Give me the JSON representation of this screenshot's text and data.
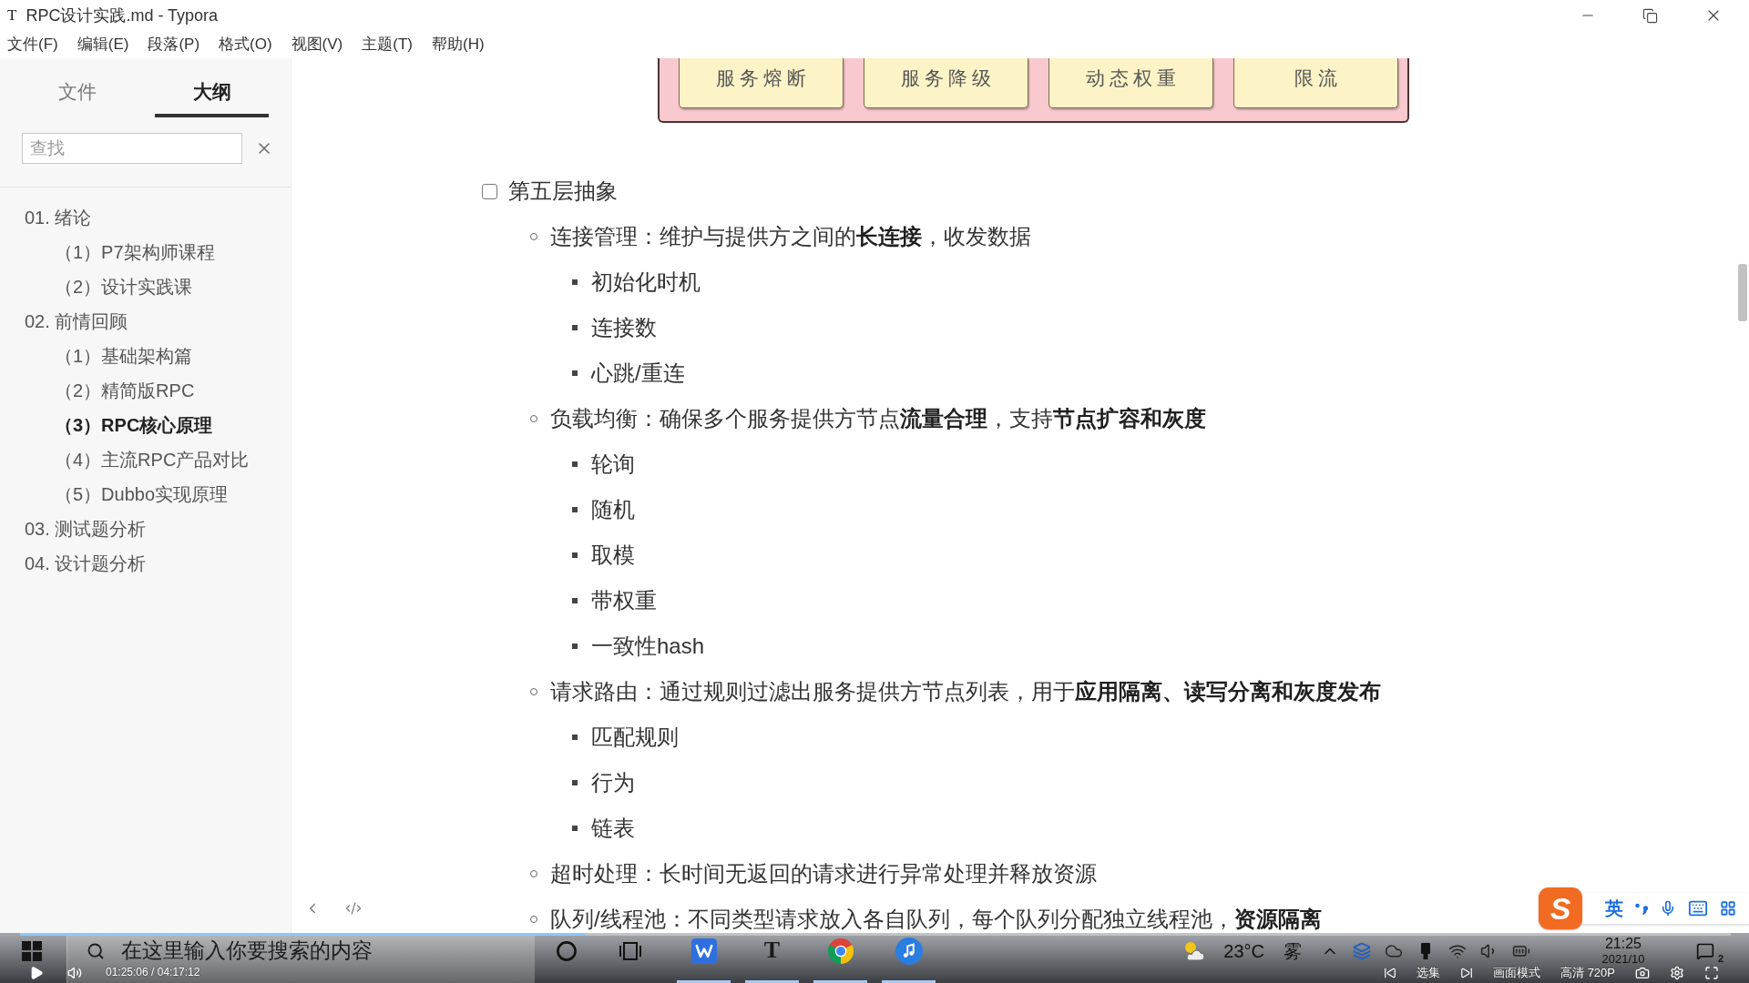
{
  "window": {
    "icon": "T",
    "title": "RPC设计实践.md - Typora"
  },
  "menu": [
    "文件(F)",
    "编辑(E)",
    "段落(P)",
    "格式(O)",
    "视图(V)",
    "主题(T)",
    "帮助(H)"
  ],
  "sidebar": {
    "tabs": [
      {
        "label": "文件",
        "selected": false
      },
      {
        "label": "大纲",
        "selected": true
      }
    ],
    "search": {
      "placeholder": "查找"
    },
    "outline": [
      {
        "label": "01. 绪论",
        "selected": false,
        "children": [
          {
            "label": "（1）P7架构师课程",
            "selected": false
          },
          {
            "label": "（2）设计实践课",
            "selected": false
          }
        ]
      },
      {
        "label": "02. 前情回顾",
        "selected": false,
        "children": [
          {
            "label": "（1）基础架构篇",
            "selected": false
          },
          {
            "label": "（2）精简版RPC",
            "selected": false
          },
          {
            "label": "（3）RPC核心原理",
            "selected": true
          },
          {
            "label": "（4）主流RPC产品对比",
            "selected": false
          },
          {
            "label": "（5）Dubbo实现原理",
            "selected": false
          }
        ]
      },
      {
        "label": "03. 测试题分析",
        "selected": false
      },
      {
        "label": "04. 设计题分析",
        "selected": false
      }
    ]
  },
  "document": {
    "diagram": {
      "boxes": [
        "服务熔断",
        "服务降级",
        "动态权重",
        "限流"
      ]
    },
    "task_list": [
      {
        "checked": false,
        "text": "第五层抽象",
        "children": [
          {
            "text": "连接管理：维护与提供方之间的**长连接**，收发数据",
            "children": [
              {
                "text": "初始化时机"
              },
              {
                "text": "连接数"
              },
              {
                "text": "心跳/重连"
              }
            ]
          },
          {
            "text": "负载均衡：确保多个服务提供方节点**流量合理**，支持**节点扩容和灰度**",
            "children": [
              {
                "text": "轮询"
              },
              {
                "text": "随机"
              },
              {
                "text": "取模"
              },
              {
                "text": "带权重"
              },
              {
                "text": "一致性hash"
              }
            ]
          },
          {
            "text": "请求路由：通过规则过滤出服务提供方节点列表，用于**应用隔离、读写分离和灰度发布**",
            "children": [
              {
                "text": "匹配规则"
              },
              {
                "text": "行为"
              },
              {
                "text": "链表"
              }
            ]
          },
          {
            "text": "超时处理：长时间无返回的请求进行异常处理并释放资源"
          },
          {
            "text": "队列/线程池：不同类型请求放入各自队列，每个队列分配独立线程池，**资源隔离**"
          }
        ]
      }
    ]
  },
  "ime": {
    "logo": "S",
    "mode": "英"
  },
  "taskbar": {
    "search": {
      "placeholder": "在这里输入你要搜索的内容"
    },
    "apps": [
      {
        "kind": "zigzag",
        "running": true
      },
      {
        "kind": "letter",
        "glyph": "T",
        "running": true
      },
      {
        "kind": "segmented",
        "running": true
      },
      {
        "kind": "music",
        "running": true
      }
    ],
    "weather": {
      "temperature": "23°C",
      "condition": "雾"
    },
    "clock": "21:25",
    "date": "2021/10",
    "notification_count": "2"
  },
  "player": {
    "playing": false,
    "progress": {
      "level": 0.33
    },
    "time": "01:25:06 / 04:17:12",
    "episodes": "选集",
    "display_mode": "画面模式",
    "quality": "高清 720P"
  }
}
